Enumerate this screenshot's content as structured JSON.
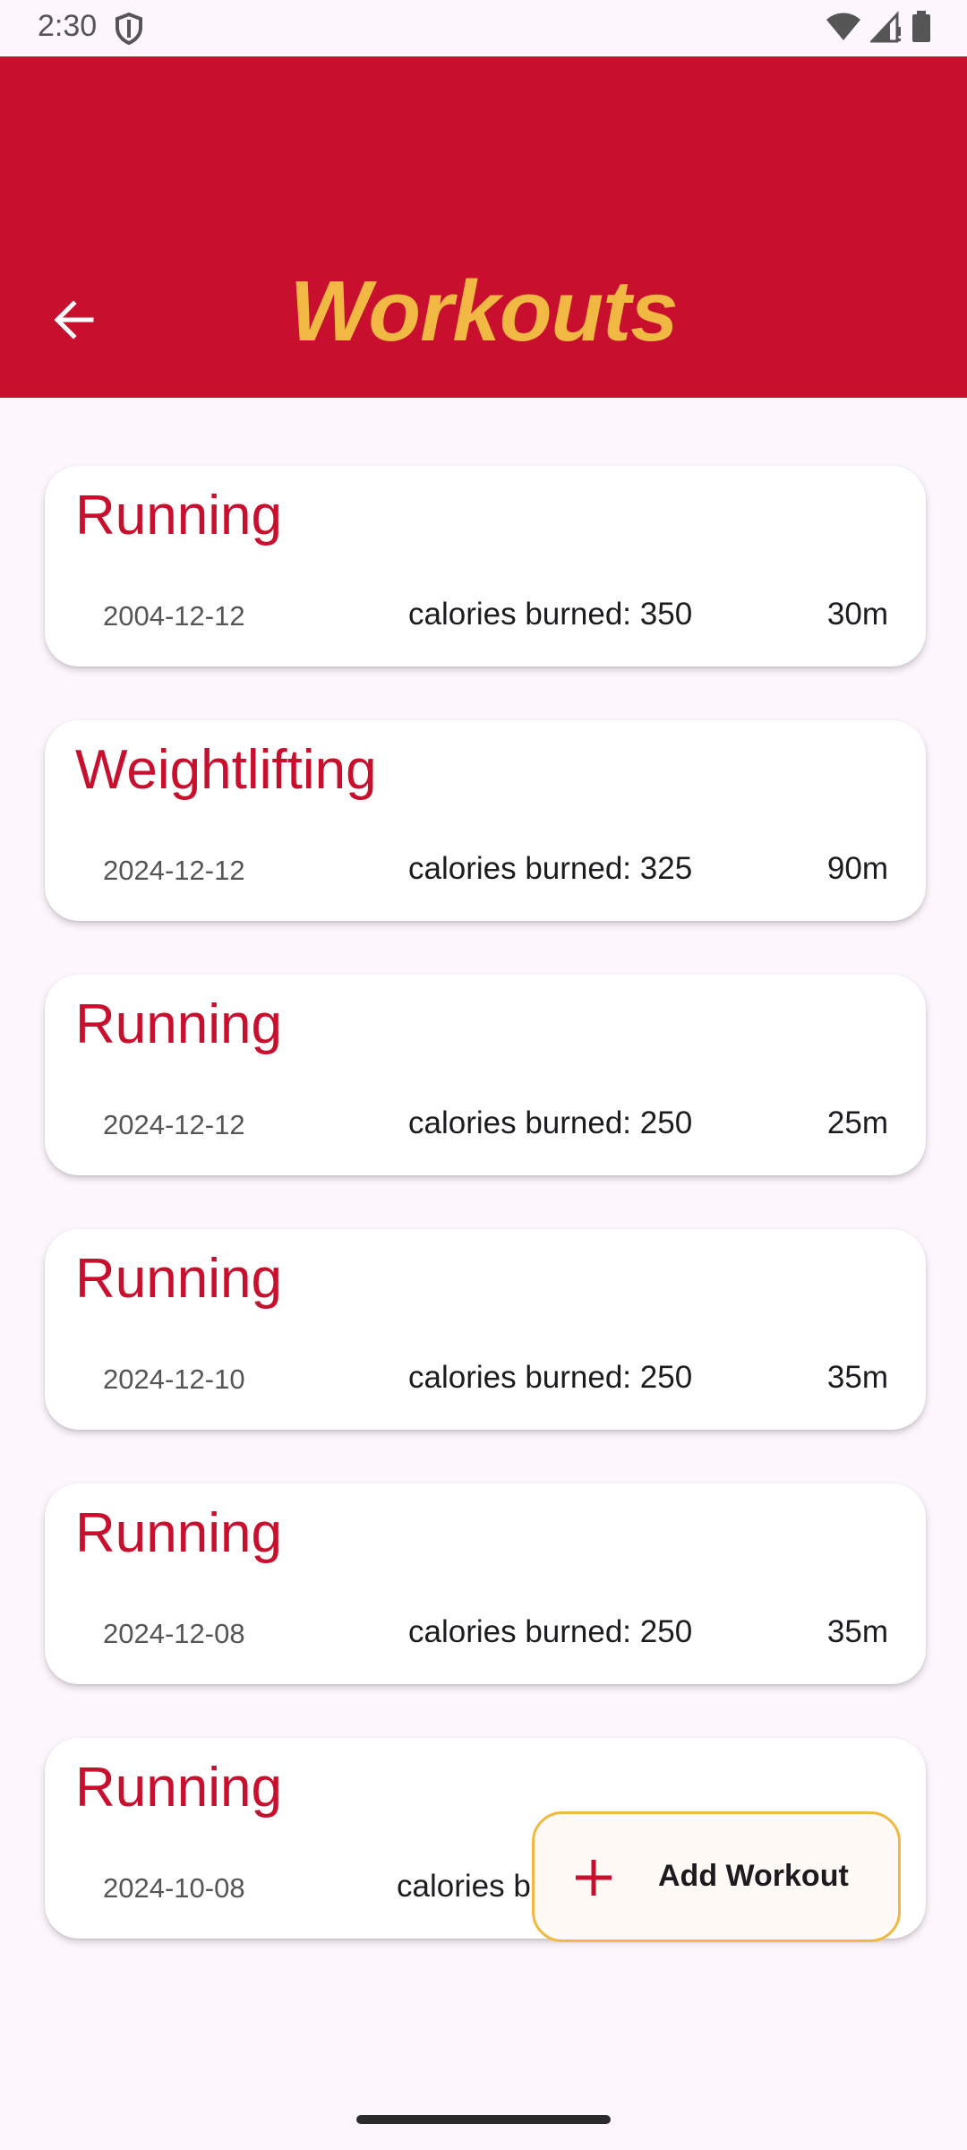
{
  "status_bar": {
    "time": "2:30",
    "icons": [
      "shield-icon",
      "wifi-icon",
      "signal-icon",
      "battery-icon"
    ]
  },
  "app_bar": {
    "title": "Workouts",
    "back_icon": "arrow-back-icon",
    "background_color": "#c8102e",
    "title_color": "#f1b943"
  },
  "workouts": [
    {
      "name": "Running",
      "date": "2004-12-12",
      "calories": "calories burned: 350",
      "duration": "30m"
    },
    {
      "name": "Weightlifting",
      "date": "2024-12-12",
      "calories": "calories burned: 325",
      "duration": "90m"
    },
    {
      "name": "Running",
      "date": "2024-12-12",
      "calories": "calories burned: 250",
      "duration": "25m"
    },
    {
      "name": "Running",
      "date": "2024-12-10",
      "calories": "calories burned: 250",
      "duration": "35m"
    },
    {
      "name": "Running",
      "date": "2024-12-08",
      "calories": "calories burned: 250",
      "duration": "35m"
    },
    {
      "name": "Running",
      "date": "2024-10-08",
      "calories": "calories b",
      "duration": ""
    }
  ],
  "fab": {
    "label": "Add Workout",
    "icon": "plus-icon"
  }
}
